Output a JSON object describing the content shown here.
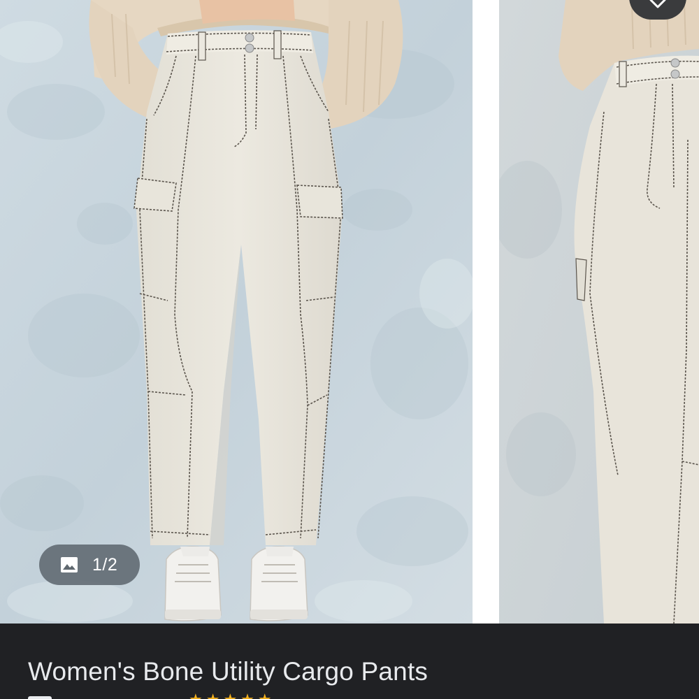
{
  "carousel": {
    "counter": "1/2",
    "counter_icon": "image-gallery-icon",
    "close_icon": "close-icon"
  },
  "product": {
    "title": "Women's Bone Utility Cargo Pants",
    "rating_icon": "star-rating-icon",
    "store_icon": "store-icon"
  },
  "colors": {
    "photo_background": "#c9d6de",
    "pants": "#e9e6dc",
    "stitching": "#55504a",
    "sweater": "#e3d3bd",
    "panel_background": "#202124",
    "title_text": "#e8eaed",
    "badge_background": "#5f686f"
  }
}
